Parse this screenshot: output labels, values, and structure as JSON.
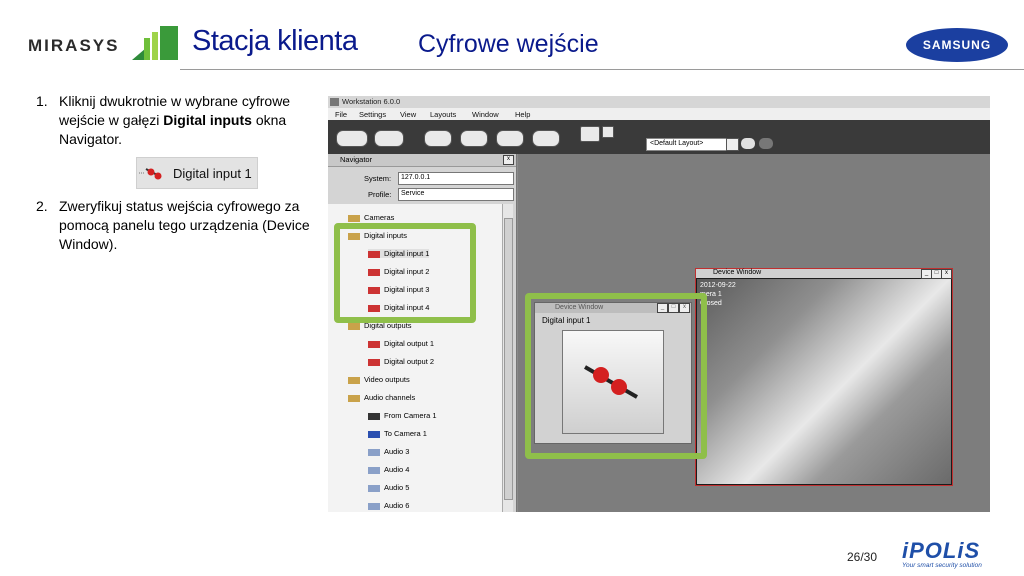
{
  "header": {
    "brand": "MIRASYS",
    "title": "Stacja klienta",
    "subtitle": "Cyfrowe wejście",
    "partner": "SAMSUNG"
  },
  "steps": [
    {
      "num": "1.",
      "pre": "Kliknij dwukrotnie w wybrane cyfrowe wejście w gałęzi ",
      "bold": "Digital inputs",
      "post": " okna Navigator."
    },
    {
      "num": "2.",
      "pre": "Zweryfikuj status wejścia cyfrowego za pomocą panelu tego urządzenia (Device Window).",
      "bold": "",
      "post": ""
    }
  ],
  "sample_label": "Digital input 1",
  "app": {
    "window_title": "Workstation 6.0.0",
    "menu": [
      "File",
      "Settings",
      "View",
      "Layouts",
      "Window",
      "Help"
    ],
    "layout_select": "<Default Layout>",
    "navigator": {
      "title": "Navigator",
      "system_label": "System:",
      "system_value": "127.0.0.1",
      "profile_label": "Profile:",
      "profile_value": "Service",
      "tree": [
        "Cameras",
        "Digital inputs",
        "Digital input 1",
        "Digital input 2",
        "Digital input 3",
        "Digital input 4",
        "Digital outputs",
        "Digital output 1",
        "Digital output 2",
        "Video outputs",
        "Audio channels",
        "From Camera 1",
        "To Camera 1",
        "Audio 3",
        "Audio 4",
        "Audio 5",
        "Audio 6"
      ]
    },
    "device_window_cam": {
      "title": "Device Window",
      "overlay_line1": "2012-09-22",
      "overlay_line2": "mera 1",
      "overlay_line3": "Closed"
    },
    "device_window_input": {
      "title": "Device Window",
      "label": "Digital input 1"
    }
  },
  "footer": {
    "page": "26/30",
    "logo": "iPOLiS",
    "tagline": "Your smart security solution"
  },
  "colors": {
    "title": "#0a1a8c",
    "highlight": "#8fbf4a",
    "samsung": "#1b3fa0"
  }
}
